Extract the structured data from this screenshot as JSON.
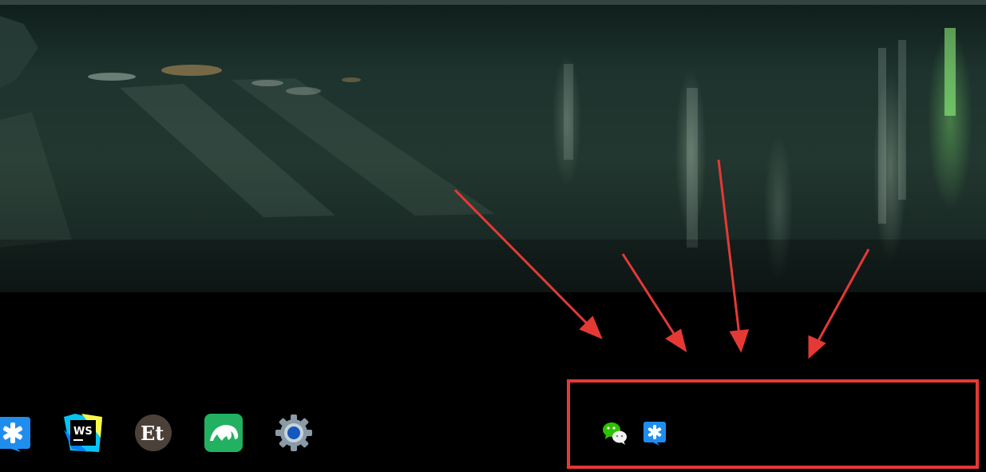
{
  "wallpaper": {
    "icon": "wet-street-night-wallpaper"
  },
  "dock": {
    "items": [
      {
        "icon": "dingtalk-icon"
      },
      {
        "icon": "webstorm-icon",
        "label": "WS"
      },
      {
        "icon": "ctrip-icon",
        "label": "Et"
      },
      {
        "icon": "manatee-app-icon"
      },
      {
        "icon": "settings-gear-icon"
      }
    ]
  },
  "tray": {
    "items": [
      {
        "icon": "wechat-icon"
      },
      {
        "icon": "dingtalk-icon"
      }
    ]
  },
  "annotation": {
    "color": "#e53935",
    "arrows": 4
  }
}
